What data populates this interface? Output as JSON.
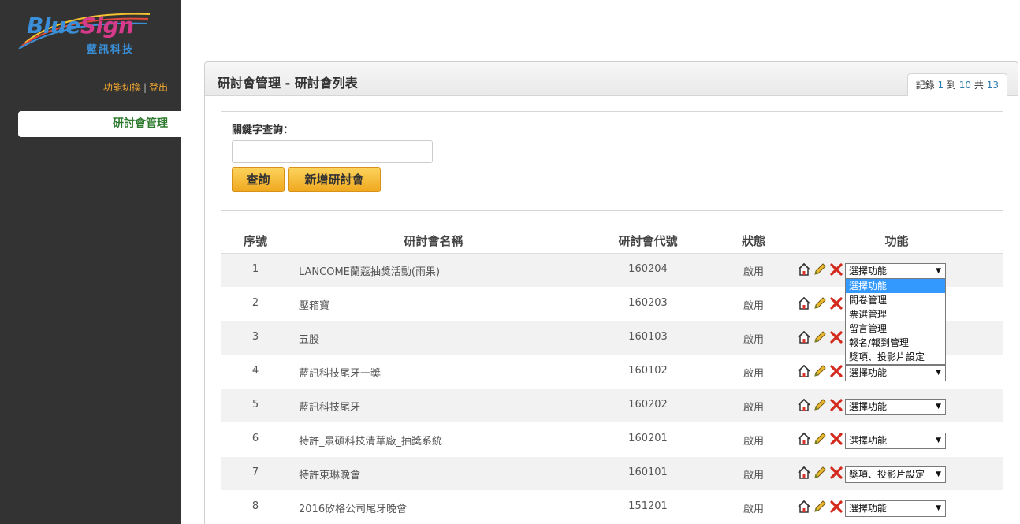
{
  "brand": {
    "name_part1": "Blue",
    "name_part2": "Sign",
    "subtitle": "藍訊科技"
  },
  "sidebar": {
    "switch_link": "功能切換",
    "separator": "|",
    "logout_link": "登出",
    "nav_items": [
      {
        "label": "研討會管理",
        "active": true
      }
    ]
  },
  "panel": {
    "title": "研討會管理 - 研討會列表",
    "record_info": {
      "prefix": "記錄 ",
      "from": "1",
      "mid1": " 到 ",
      "to": "10",
      "mid2": " 共 ",
      "total": "13"
    }
  },
  "search": {
    "label": "關鍵字查詢：",
    "input_value": "",
    "query_button": "查詢",
    "add_button": "新增研討會"
  },
  "table": {
    "headers": [
      "序號",
      "研討會名稱",
      "研討會代號",
      "狀態",
      "功能"
    ],
    "rows": [
      {
        "no": "1",
        "name": "LANCOME蘭蔻抽獎活動(雨果)",
        "code": "160204",
        "status": "啟用",
        "function": "選擇功能"
      },
      {
        "no": "2",
        "name": "壓箱寶",
        "code": "160203",
        "status": "啟用",
        "function": "選擇功能"
      },
      {
        "no": "3",
        "name": "五股",
        "code": "160103",
        "status": "啟用",
        "function": "選擇功能"
      },
      {
        "no": "4",
        "name": "藍訊科技尾牙一獎",
        "code": "160102",
        "status": "啟用",
        "function": "選擇功能"
      },
      {
        "no": "5",
        "name": "藍訊科技尾牙",
        "code": "160202",
        "status": "啟用",
        "function": "選擇功能"
      },
      {
        "no": "6",
        "name": "特許_景碩科技清華廠_抽獎系統",
        "code": "160201",
        "status": "啟用",
        "function": "選擇功能"
      },
      {
        "no": "7",
        "name": "特許東琳晚會",
        "code": "160101",
        "status": "啟用",
        "function": "獎項、投影片設定"
      },
      {
        "no": "8",
        "name": "2016矽格公司尾牙晚會",
        "code": "151201",
        "status": "啟用",
        "function": "選擇功能"
      }
    ]
  },
  "dropdown_open": {
    "options": [
      "選擇功能",
      "問卷管理",
      "票選管理",
      "留言管理",
      "報名/報到管理",
      "獎項、投影片設定"
    ],
    "selected_index": 0
  },
  "icons": {
    "home": "home-icon",
    "edit": "pencil-icon",
    "delete": "delete-x-icon"
  },
  "colors": {
    "sidebar_bg": "#333333",
    "accent_orange": "#f0a830",
    "nav_active_text": "#2d7a2d",
    "button_gradient_top": "#fcd35c",
    "button_gradient_bottom": "#f0a81f",
    "row_alt": "#f2f2f2",
    "dropdown_highlight": "#3399ff"
  }
}
